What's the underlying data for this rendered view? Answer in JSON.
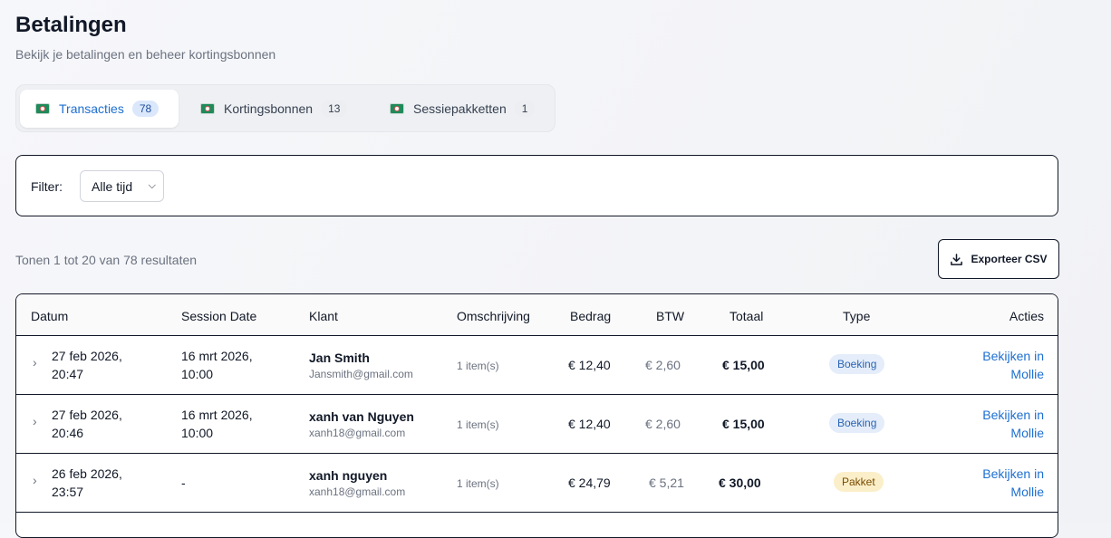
{
  "page": {
    "title": "Betalingen",
    "subtitle": "Bekijk je betalingen en beheer kortingsbonnen"
  },
  "tabs": [
    {
      "label": "Transacties",
      "count": "78",
      "icon": "payments-icon"
    },
    {
      "label": "Kortingsbonnen",
      "count": "13",
      "icon": "payments-icon"
    },
    {
      "label": "Sessiepakketten",
      "count": "1",
      "icon": "payments-icon"
    }
  ],
  "filter": {
    "label": "Filter:",
    "selected": "Alle tijd"
  },
  "results": {
    "summary": "Tonen 1 tot 20 van 78 resultaten"
  },
  "export": {
    "label": "Exporteer CSV"
  },
  "table": {
    "headers": [
      "Datum",
      "Session Date",
      "Klant",
      "Omschrijving",
      "Bedrag",
      "BTW",
      "Totaal",
      "Type",
      "Acties"
    ],
    "rows": [
      {
        "date1": "27 feb 2026,",
        "date2": "20:47",
        "sess1": "16 mrt 2026,",
        "sess2": "10:00",
        "name": "Jan Smith",
        "email": "Jansmith@gmail.com",
        "desc": "1 item(s)",
        "bedrag": "€ 12,40",
        "btw": "€ 2,60",
        "totaal": "€ 15,00",
        "type": "Boeking",
        "action1": "Bekijken in",
        "action2": "Mollie"
      },
      {
        "date1": "27 feb 2026,",
        "date2": "20:46",
        "sess1": "16 mrt 2026,",
        "sess2": "10:00",
        "name": "xanh van Nguyen",
        "email": "xanh18@gmail.com",
        "desc": "1 item(s)",
        "bedrag": "€ 12,40",
        "btw": "€ 2,60",
        "totaal": "€ 15,00",
        "type": "Boeking",
        "action1": "Bekijken in",
        "action2": "Mollie"
      },
      {
        "date1": "26 feb 2026,",
        "date2": "23:57",
        "sess1": "-",
        "sess2": "",
        "name": "xanh nguyen",
        "email": "xanh18@gmail.com",
        "desc": "1 item(s)",
        "bedrag": "€ 24,79",
        "btw": "€ 5,21",
        "totaal": "€ 30,00",
        "type": "Pakket",
        "action1": "Bekijken in",
        "action2": "Mollie"
      }
    ]
  },
  "colors": {
    "accent": "#1d6fd1",
    "booking_pill": "#e4edf9",
    "pakket_pill": "#fbefc9"
  }
}
